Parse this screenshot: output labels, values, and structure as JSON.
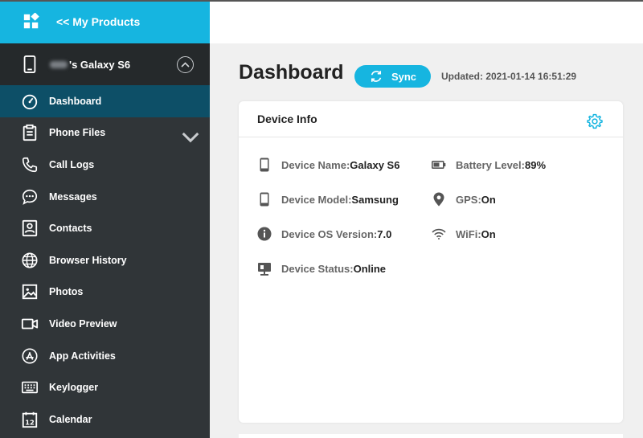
{
  "brand": {
    "label": "<< My Products"
  },
  "device": {
    "name_suffix": "'s Galaxy S6"
  },
  "nav": [
    {
      "label": "Dashboard",
      "icon": "speedometer-icon",
      "active": true
    },
    {
      "label": "Phone Files",
      "icon": "clipboard-icon",
      "expandable": true
    },
    {
      "label": "Call Logs",
      "icon": "phone-icon"
    },
    {
      "label": "Messages",
      "icon": "chat-bubble-icon"
    },
    {
      "label": "Contacts",
      "icon": "contact-card-icon"
    },
    {
      "label": "Browser History",
      "icon": "globe-icon"
    },
    {
      "label": "Photos",
      "icon": "image-icon"
    },
    {
      "label": "Video Preview",
      "icon": "video-camera-icon"
    },
    {
      "label": "App Activities",
      "icon": "app-store-icon"
    },
    {
      "label": "Keylogger",
      "icon": "keyboard-icon"
    },
    {
      "label": "Calendar",
      "icon": "calendar-icon"
    }
  ],
  "header": {
    "title": "Dashboard",
    "sync_label": "Sync",
    "updated": "Updated: 2021-01-14 16:51:29"
  },
  "card": {
    "title": "Device Info",
    "left": [
      {
        "key": "Device Name:",
        "value": "Galaxy S6",
        "icon": "mobile-phone-icon"
      },
      {
        "key": "Device Model:",
        "value": "Samsung",
        "icon": "mobile-phone-icon"
      },
      {
        "key": "Device OS Version:",
        "value": "7.0",
        "icon": "info-circle-icon"
      },
      {
        "key": "Device Status:",
        "value": "Online",
        "icon": "monitor-status-icon"
      }
    ],
    "right": [
      {
        "key": "Battery Level:",
        "value": "89%",
        "icon": "battery-icon"
      },
      {
        "key": "GPS:",
        "value": "On",
        "icon": "location-pin-icon"
      },
      {
        "key": "WiFi:",
        "value": "On",
        "icon": "wifi-icon"
      }
    ]
  },
  "colors": {
    "accent": "#16b5e0",
    "sidebar": "#303538",
    "active": "#0d4f67"
  }
}
